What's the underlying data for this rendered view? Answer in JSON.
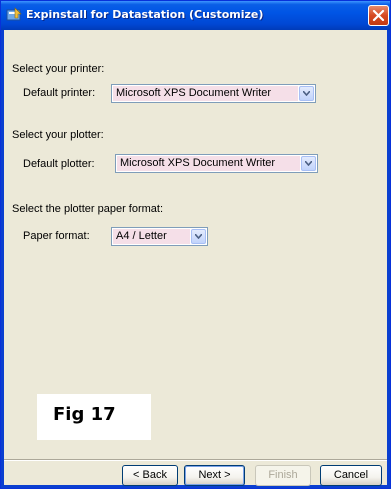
{
  "window": {
    "title": "Expinstall for Datastation (Customize)",
    "app_icon": "installer-icon",
    "close_icon": "close-icon"
  },
  "printer": {
    "section_label": "Select your printer:",
    "field_label": "Default printer:",
    "value": "Microsoft XPS Document Writer"
  },
  "plotter": {
    "section_label": "Select your plotter:",
    "field_label": "Default plotter:",
    "value": "Microsoft XPS Document Writer"
  },
  "paper": {
    "section_label": "Select the plotter paper format:",
    "field_label": "Paper format:",
    "value": "A4 / Letter"
  },
  "figure": {
    "label": "Fig 17"
  },
  "buttons": {
    "back": "< Back",
    "next": "Next >",
    "finish": "Finish",
    "cancel": "Cancel"
  },
  "colors": {
    "title_bar": "#0055e5",
    "client_bg": "#ece9d8",
    "combo_highlight": "#f5dfe8"
  }
}
